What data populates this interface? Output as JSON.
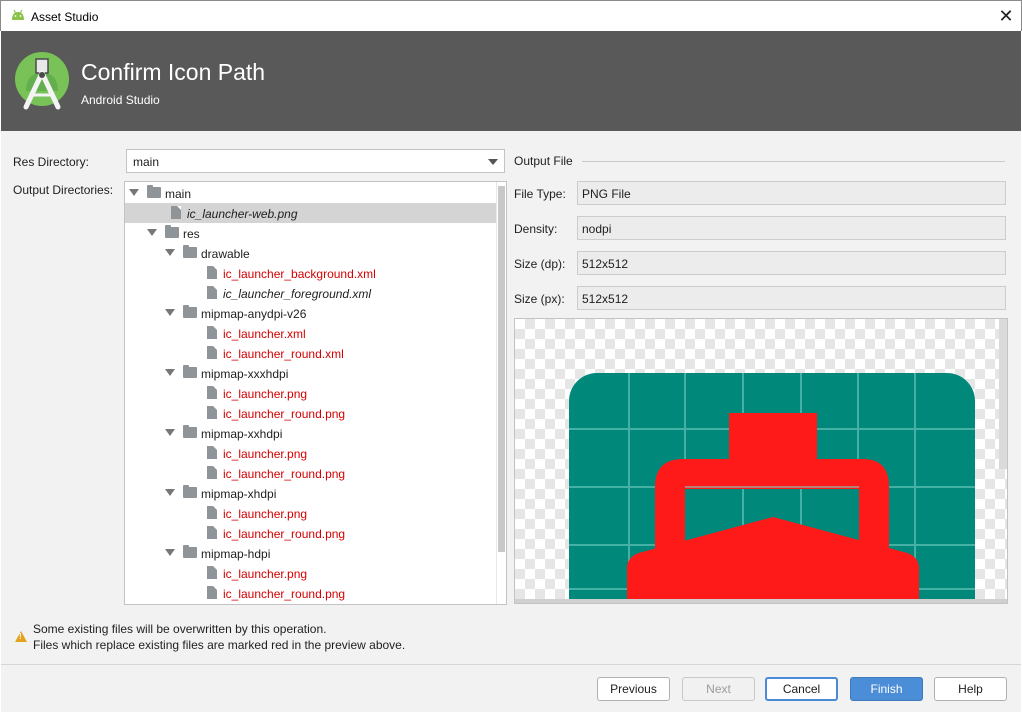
{
  "window": {
    "title": "Asset Studio",
    "close_glyph": "✕"
  },
  "header": {
    "title": "Confirm Icon Path",
    "subtitle": "Android Studio"
  },
  "form": {
    "res_directory_label": "Res Directory:",
    "res_directory_value": "main",
    "output_directories_label": "Output Directories:"
  },
  "tree": [
    {
      "label": "main",
      "type": "folder",
      "depth": 0,
      "expanded": true,
      "status": "normal"
    },
    {
      "label": "ic_launcher-web.png",
      "type": "file",
      "depth": 1,
      "status": "new",
      "selected": true
    },
    {
      "label": "res",
      "type": "folder",
      "depth": 1,
      "expanded": true,
      "status": "normal"
    },
    {
      "label": "drawable",
      "type": "folder",
      "depth": 2,
      "expanded": true,
      "status": "normal"
    },
    {
      "label": "ic_launcher_background.xml",
      "type": "file",
      "depth": 3,
      "status": "overwrite"
    },
    {
      "label": "ic_launcher_foreground.xml",
      "type": "file",
      "depth": 3,
      "status": "new"
    },
    {
      "label": "mipmap-anydpi-v26",
      "type": "folder",
      "depth": 2,
      "expanded": true,
      "status": "normal"
    },
    {
      "label": "ic_launcher.xml",
      "type": "file",
      "depth": 3,
      "status": "overwrite"
    },
    {
      "label": "ic_launcher_round.xml",
      "type": "file",
      "depth": 3,
      "status": "overwrite"
    },
    {
      "label": "mipmap-xxxhdpi",
      "type": "folder",
      "depth": 2,
      "expanded": true,
      "status": "normal"
    },
    {
      "label": "ic_launcher.png",
      "type": "file",
      "depth": 3,
      "status": "overwrite"
    },
    {
      "label": "ic_launcher_round.png",
      "type": "file",
      "depth": 3,
      "status": "overwrite"
    },
    {
      "label": "mipmap-xxhdpi",
      "type": "folder",
      "depth": 2,
      "expanded": true,
      "status": "normal"
    },
    {
      "label": "ic_launcher.png",
      "type": "file",
      "depth": 3,
      "status": "overwrite"
    },
    {
      "label": "ic_launcher_round.png",
      "type": "file",
      "depth": 3,
      "status": "overwrite"
    },
    {
      "label": "mipmap-xhdpi",
      "type": "folder",
      "depth": 2,
      "expanded": true,
      "status": "normal"
    },
    {
      "label": "ic_launcher.png",
      "type": "file",
      "depth": 3,
      "status": "overwrite"
    },
    {
      "label": "ic_launcher_round.png",
      "type": "file",
      "depth": 3,
      "status": "overwrite"
    },
    {
      "label": "mipmap-hdpi",
      "type": "folder",
      "depth": 2,
      "expanded": true,
      "status": "normal"
    },
    {
      "label": "ic_launcher.png",
      "type": "file",
      "depth": 3,
      "status": "overwrite"
    },
    {
      "label": "ic_launcher_round.png",
      "type": "file",
      "depth": 3,
      "status": "overwrite"
    }
  ],
  "output_file": {
    "section_label": "Output File",
    "file_type_label": "File Type:",
    "file_type_value": "PNG File",
    "density_label": "Density:",
    "density_value": "nodpi",
    "size_dp_label": "Size (dp):",
    "size_dp_value": "512x512",
    "size_px_label": "Size (px):",
    "size_px_value": "512x512"
  },
  "preview": {
    "icon_background_color": "#00897b",
    "icon_foreground_color": "#ff1a1a",
    "grid_line_color": "#7fd0c6"
  },
  "warning": {
    "icon": "warning-triangle-icon",
    "line1": "Some existing files will be overwritten by this operation.",
    "line2": "Files which replace existing files are marked red in the preview above."
  },
  "buttons": {
    "previous": "Previous",
    "next": "Next",
    "cancel": "Cancel",
    "finish": "Finish",
    "help": "Help"
  },
  "colors": {
    "header_bg": "#595959",
    "overwrite_text": "#d40000",
    "primary_button": "#4b8dd6"
  }
}
